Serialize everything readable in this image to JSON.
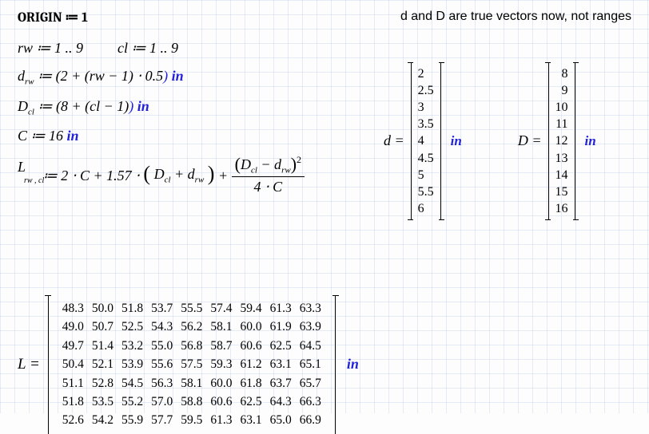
{
  "header": {
    "origin": "ORIGIN ≔ 1",
    "note": "d and D are true vectors now, not ranges"
  },
  "ranges": {
    "rw": "rw ≔ 1 .. 9",
    "cl": "cl ≔ 1 .. 9"
  },
  "defs": {
    "d_lhs": "d",
    "d_sub": "rw",
    "d_expr": "≔ (2 + (rw − 1) ⋅ 0.5",
    "d_close": ")",
    "D_lhs": "D",
    "D_sub": "cl",
    "D_expr": "≔ (8 + (cl − 1)",
    "D_close": ")",
    "C_expr": "C ≔ 16",
    "unit": "in"
  },
  "formula": {
    "L": "L",
    "Lsub": "rw , cl",
    "assign": "≔ 2 ⋅ C + 1.57 ⋅ ",
    "lpar": "(",
    "inner": "D",
    "inner_sub_cl": "cl",
    "plus": " + d",
    "inner_sub_rw": "rw",
    "rpar": ")",
    "plus2": " + ",
    "num_l": "(",
    "num_D": "D",
    "num_minus": " − d",
    "num_r": ")",
    "sq": "2",
    "den": "4 ⋅ C"
  },
  "vec_d": {
    "label": "d =",
    "unit": "in",
    "values": [
      "2",
      "2.5",
      "3",
      "3.5",
      "4",
      "4.5",
      "5",
      "5.5",
      "6"
    ]
  },
  "vec_D": {
    "label": "D =",
    "unit": "in",
    "values": [
      "8",
      "9",
      "10",
      "11",
      "12",
      "13",
      "14",
      "15",
      "16"
    ]
  },
  "matrix": {
    "label": "L =",
    "unit": "in",
    "rows": [
      [
        "48.3",
        "50.0",
        "51.8",
        "53.7",
        "55.5",
        "57.4",
        "59.4",
        "61.3",
        "63.3"
      ],
      [
        "49.0",
        "50.7",
        "52.5",
        "54.3",
        "56.2",
        "58.1",
        "60.0",
        "61.9",
        "63.9"
      ],
      [
        "49.7",
        "51.4",
        "53.2",
        "55.0",
        "56.8",
        "58.7",
        "60.6",
        "62.5",
        "64.5"
      ],
      [
        "50.4",
        "52.1",
        "53.9",
        "55.6",
        "57.5",
        "59.3",
        "61.2",
        "63.1",
        "65.1"
      ],
      [
        "51.1",
        "52.8",
        "54.5",
        "56.3",
        "58.1",
        "60.0",
        "61.8",
        "63.7",
        "65.7"
      ],
      [
        "51.8",
        "53.5",
        "55.2",
        "57.0",
        "58.8",
        "60.6",
        "62.5",
        "64.3",
        "66.3"
      ],
      [
        "52.6",
        "54.2",
        "55.9",
        "57.7",
        "59.5",
        "61.3",
        "63.1",
        "65.0",
        "66.9"
      ]
    ]
  }
}
